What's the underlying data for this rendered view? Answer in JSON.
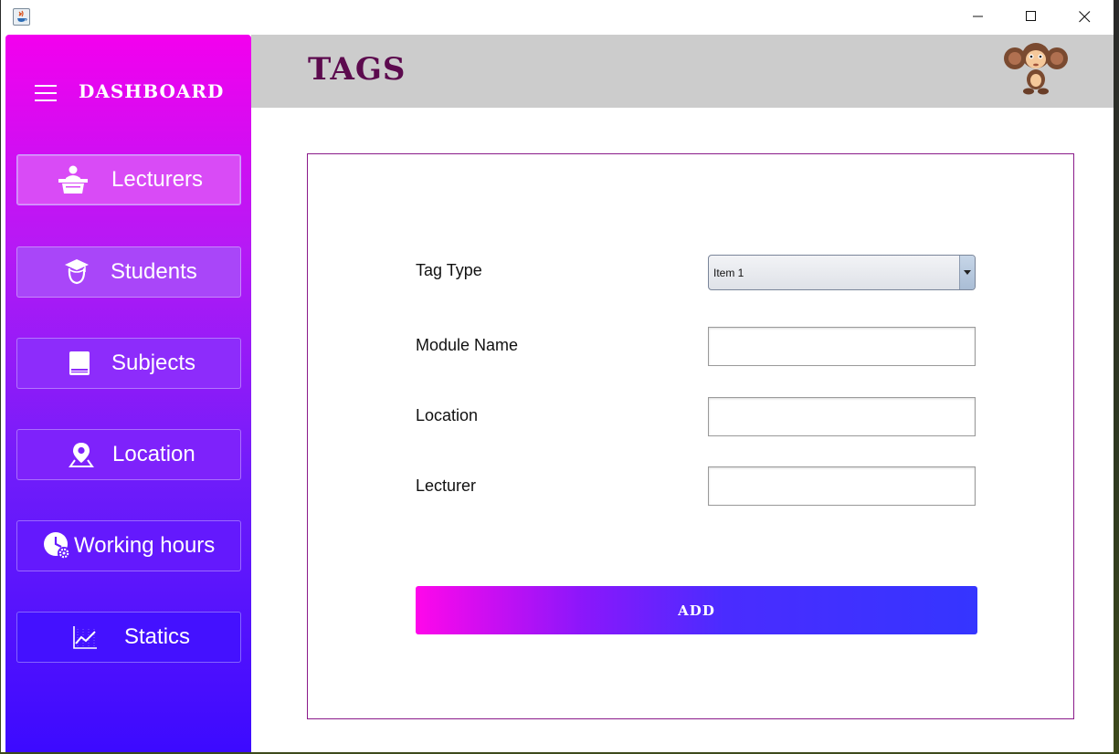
{
  "window": {
    "controls": {
      "minimize_icon": "minimize-icon",
      "maximize_icon": "maximize-icon",
      "close_icon": "close-icon"
    }
  },
  "sidebar": {
    "title": "DASHBOARD",
    "menu_icon": "hamburger-menu-icon",
    "items": [
      {
        "label": "Lecturers",
        "icon": "lecturer-podium-icon",
        "active": true
      },
      {
        "label": "Students",
        "icon": "graduate-student-icon"
      },
      {
        "label": "Subjects",
        "icon": "book-icon"
      },
      {
        "label": "Location",
        "icon": "map-pin-icon"
      },
      {
        "label": "Working hours",
        "icon": "clock-gear-icon"
      },
      {
        "label": "Statics",
        "icon": "line-chart-icon"
      }
    ],
    "gradient": [
      "#f300ee",
      "#3c0aff"
    ]
  },
  "header": {
    "title": "TAGS",
    "title_color": "#5c0a4e",
    "avatar_icon": "monkey-mascot-avatar"
  },
  "form": {
    "tag_type_label": "Tag Type",
    "tag_type_value": "Item 1",
    "module_name_label": "Module Name",
    "module_name_value": "",
    "location_label": "Location",
    "location_value": "",
    "lecturer_label": "Lecturer",
    "lecturer_value": "",
    "add_button_label": "ADD"
  }
}
